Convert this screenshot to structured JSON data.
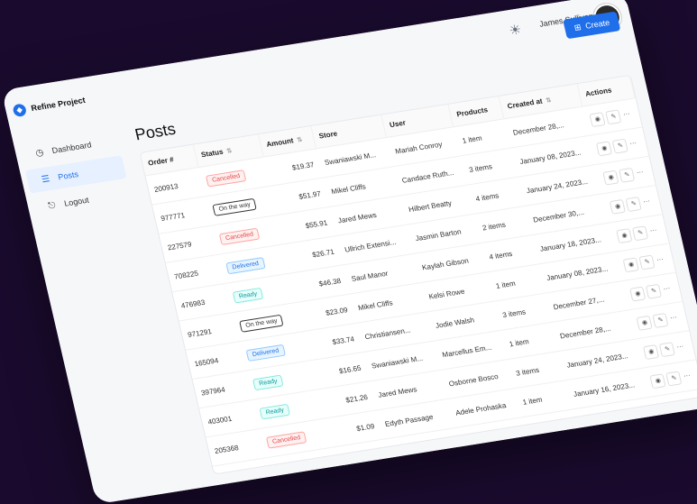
{
  "app": {
    "title": "Refine Project"
  },
  "header": {
    "user_name": "James Sullivan",
    "theme_icon": "sun-icon"
  },
  "sidebar": {
    "items": [
      {
        "label": "Dashboard",
        "icon": "dashboard-icon"
      },
      {
        "label": "Posts",
        "icon": "list-icon",
        "active": true
      },
      {
        "label": "Logout",
        "icon": "logout-icon"
      }
    ]
  },
  "main": {
    "title": "Posts",
    "create_label": "Create"
  },
  "table": {
    "columns": [
      "Order #",
      "Status",
      "Amount",
      "Store",
      "User",
      "Products",
      "Created at",
      "Actions"
    ],
    "rows": [
      {
        "order": "200913",
        "status": "Cancelled",
        "amount": "$19.37",
        "store": "Swaniawski M...",
        "user": "Mariah Conroy",
        "products": "1 item",
        "created": "December 28,..."
      },
      {
        "order": "977771",
        "status": "On the way",
        "amount": "$51.97",
        "store": "Mikel Cliffs",
        "user": "Candace Ruth...",
        "products": "3 items",
        "created": "January 08, 2023..."
      },
      {
        "order": "227579",
        "status": "Cancelled",
        "amount": "$55.91",
        "store": "Jared Mews",
        "user": "Hilbert Beatty",
        "products": "4 items",
        "created": "January 24, 2023..."
      },
      {
        "order": "708225",
        "status": "Delivered",
        "amount": "$26.71",
        "store": "Ullrich Extensi...",
        "user": "Jasmin Barton",
        "products": "2 items",
        "created": "December 30,..."
      },
      {
        "order": "476983",
        "status": "Ready",
        "amount": "$46.38",
        "store": "Saul Manor",
        "user": "Kaylah Gibson",
        "products": "4 items",
        "created": "January 18, 2023..."
      },
      {
        "order": "971291",
        "status": "On the way",
        "amount": "$23.09",
        "store": "Mikel Cliffs",
        "user": "Kelsi Rowe",
        "products": "1 item",
        "created": "January 08, 2023..."
      },
      {
        "order": "165094",
        "status": "Delivered",
        "amount": "$33.74",
        "store": "Christiansen...",
        "user": "Jodie Walsh",
        "products": "3 items",
        "created": "December 27,..."
      },
      {
        "order": "397964",
        "status": "Ready",
        "amount": "$16.65",
        "store": "Swaniawski M...",
        "user": "Marcellus Em...",
        "products": "1 item",
        "created": "December 28,..."
      },
      {
        "order": "403001",
        "status": "Ready",
        "amount": "$21.26",
        "store": "Jared Mews",
        "user": "Osborne Bosco",
        "products": "3 items",
        "created": "January 24, 2023..."
      },
      {
        "order": "205368",
        "status": "Cancelled",
        "amount": "$1.09",
        "store": "Edyth Passage",
        "user": "Adele Prohaska",
        "products": "1 item",
        "created": "January 16, 2023..."
      }
    ]
  },
  "colors": {
    "background": "#1a0b2e",
    "accent": "#1f6feb",
    "cancelled": "#e5484d",
    "on_the_way": "#389e0d",
    "delivered": "#1f6feb",
    "ready": "#08979c"
  }
}
